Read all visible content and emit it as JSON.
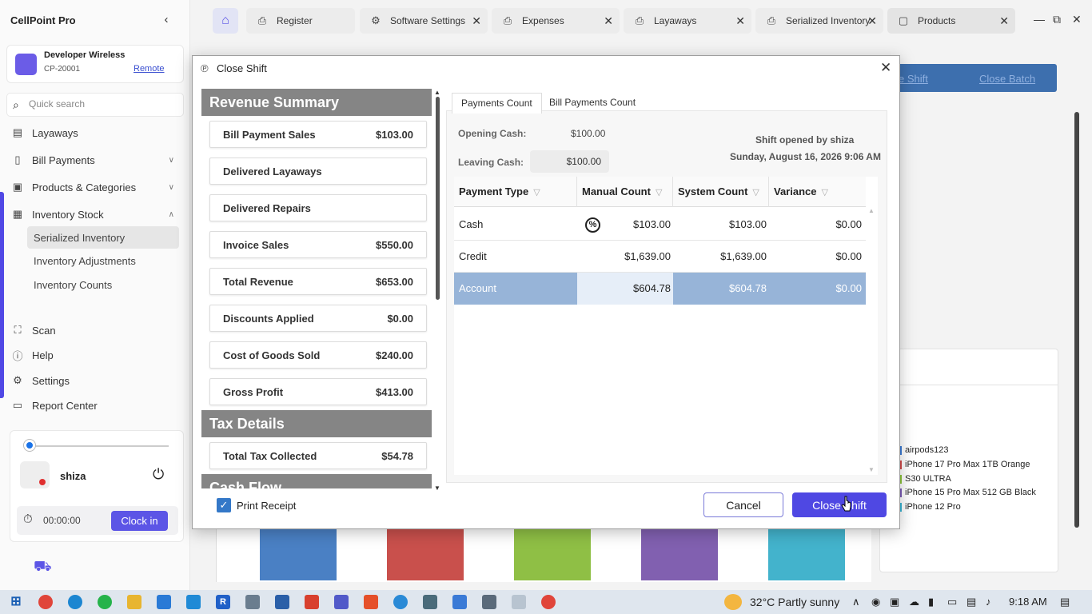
{
  "app": {
    "title": "CellPoint Pro"
  },
  "account": {
    "name": "Developer Wireless",
    "id": "CP-20001",
    "remote_label": "Remote"
  },
  "search": {
    "placeholder": "Quick search"
  },
  "sidebar": {
    "items": [
      {
        "label": "Layaways",
        "icon": "calendar-icon"
      },
      {
        "label": "Bill Payments",
        "icon": "document-icon"
      },
      {
        "label": "Products & Categories",
        "icon": "box-icon"
      },
      {
        "label": "Inventory Stock",
        "icon": "stock-icon"
      }
    ],
    "sub_items": [
      {
        "label": "Serialized Inventory",
        "active": true
      },
      {
        "label": "Inventory Adjustments"
      },
      {
        "label": "Inventory Counts"
      }
    ],
    "bottom_items": [
      {
        "label": "Scan",
        "icon": "scan-icon"
      },
      {
        "label": "Help",
        "icon": "help-icon"
      },
      {
        "label": "Settings",
        "icon": "gear-icon"
      },
      {
        "label": "Report Center",
        "icon": "report-icon"
      }
    ]
  },
  "user": {
    "name": "shiza",
    "timer": "00:00:00",
    "clock_in_label": "Clock in"
  },
  "tabs": [
    {
      "label": "Register",
      "icon": "printer-icon"
    },
    {
      "label": "Software Settings",
      "icon": "settings-icon"
    },
    {
      "label": "Expenses",
      "icon": "printer-icon"
    },
    {
      "label": "Layaways",
      "icon": "printer-icon"
    },
    {
      "label": "Serialized Inventory",
      "icon": "printer-icon"
    },
    {
      "label": "Products",
      "icon": "products-icon"
    }
  ],
  "background": {
    "link1": "e Shift",
    "link2": "Close Batch",
    "legend": [
      {
        "label": "airpods123",
        "color": "#3b7bd4"
      },
      {
        "label": "iPhone 17 Pro Max 1TB Orange",
        "color": "#d04a4a"
      },
      {
        "label": "S30 ULTRA",
        "color": "#8cc43c"
      },
      {
        "label": "iPhone 15 Pro Max 512 GB Black",
        "color": "#7a5bb5"
      },
      {
        "label": "iPhone 12 Pro",
        "color": "#3ab5d4"
      }
    ]
  },
  "dialog": {
    "title": "Close Shift",
    "revenue_summary": {
      "heading": "Revenue Summary",
      "rows": [
        {
          "label": "Bill Payment Sales",
          "value": "$103.00"
        },
        {
          "label": "Delivered Layaways",
          "value": ""
        },
        {
          "label": "Delivered Repairs",
          "value": ""
        },
        {
          "label": "Invoice Sales",
          "value": "$550.00"
        },
        {
          "label": "Total Revenue",
          "value": "$653.00"
        },
        {
          "label": "Discounts Applied",
          "value": "$0.00"
        },
        {
          "label": "Cost of Goods Sold",
          "value": "$240.00"
        },
        {
          "label": "Gross Profit",
          "value": "$413.00"
        }
      ]
    },
    "tax_details": {
      "heading": "Tax Details",
      "rows": [
        {
          "label": "Total Tax Collected",
          "value": "$54.78"
        }
      ]
    },
    "cash_flow": {
      "heading": "Cash Flow"
    },
    "print_receipt_label": "Print Receipt",
    "print_receipt_checked": true,
    "tabs": [
      "Payments Count",
      "Bill Payments Count"
    ],
    "opening_cash_label": "Opening Cash:",
    "opening_cash_value": "$100.00",
    "leaving_cash_label": "Leaving Cash:",
    "leaving_cash_value": "$100.00",
    "shift_opened_by": "Shift opened by shiza",
    "shift_opened_date": "Sunday, August 16, 2026 9:06 AM",
    "grid": {
      "columns": [
        "Payment Type",
        "Manual Count",
        "System Count",
        "Variance"
      ],
      "rows": [
        {
          "type": "Cash",
          "manual": "$103.00",
          "system": "$103.00",
          "variance": "$0.00"
        },
        {
          "type": "Credit",
          "manual": "$1,639.00",
          "system": "$1,639.00",
          "variance": "$0.00"
        },
        {
          "type": "Account",
          "manual": "$604.78",
          "system": "$604.78",
          "variance": "$0.00"
        }
      ]
    },
    "cancel_label": "Cancel",
    "close_shift_label": "Close Shift"
  },
  "taskbar": {
    "weather": "32°C  Partly sunny",
    "time": "9:18 AM"
  }
}
